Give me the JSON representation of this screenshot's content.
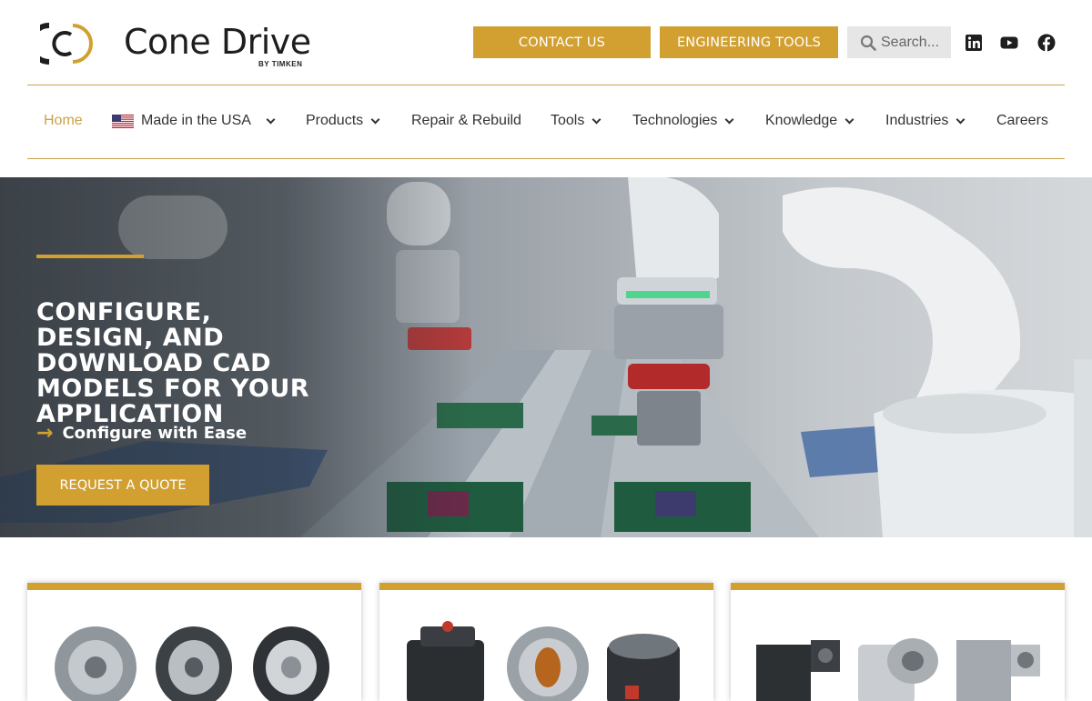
{
  "brand": {
    "name": "Cone Drive",
    "sub": "BY TIMKEN",
    "accent": "#d1a031"
  },
  "header": {
    "contact_label": "CONTACT US",
    "tools_label": "ENGINEERING TOOLS",
    "search_placeholder": "Search...",
    "social": [
      "linkedin-icon",
      "youtube-icon",
      "facebook-icon"
    ]
  },
  "nav": {
    "items": [
      {
        "label": "Home",
        "active": true
      },
      {
        "label": "Made in the USA",
        "dropdown": true
      },
      {
        "label": "Products",
        "dropdown": true
      },
      {
        "label": "Repair & Rebuild"
      },
      {
        "label": "Tools",
        "dropdown": true
      },
      {
        "label": "Technologies",
        "dropdown": true
      },
      {
        "label": "Knowledge",
        "dropdown": true
      },
      {
        "label": "Industries",
        "dropdown": true
      },
      {
        "label": "Careers"
      }
    ]
  },
  "hero": {
    "title": "CONFIGURE, DESIGN, AND DOWNLOAD CAD MODELS FOR YOUR APPLICATION",
    "subtitle": "Configure with Ease",
    "cta_label": "REQUEST A QUOTE"
  }
}
